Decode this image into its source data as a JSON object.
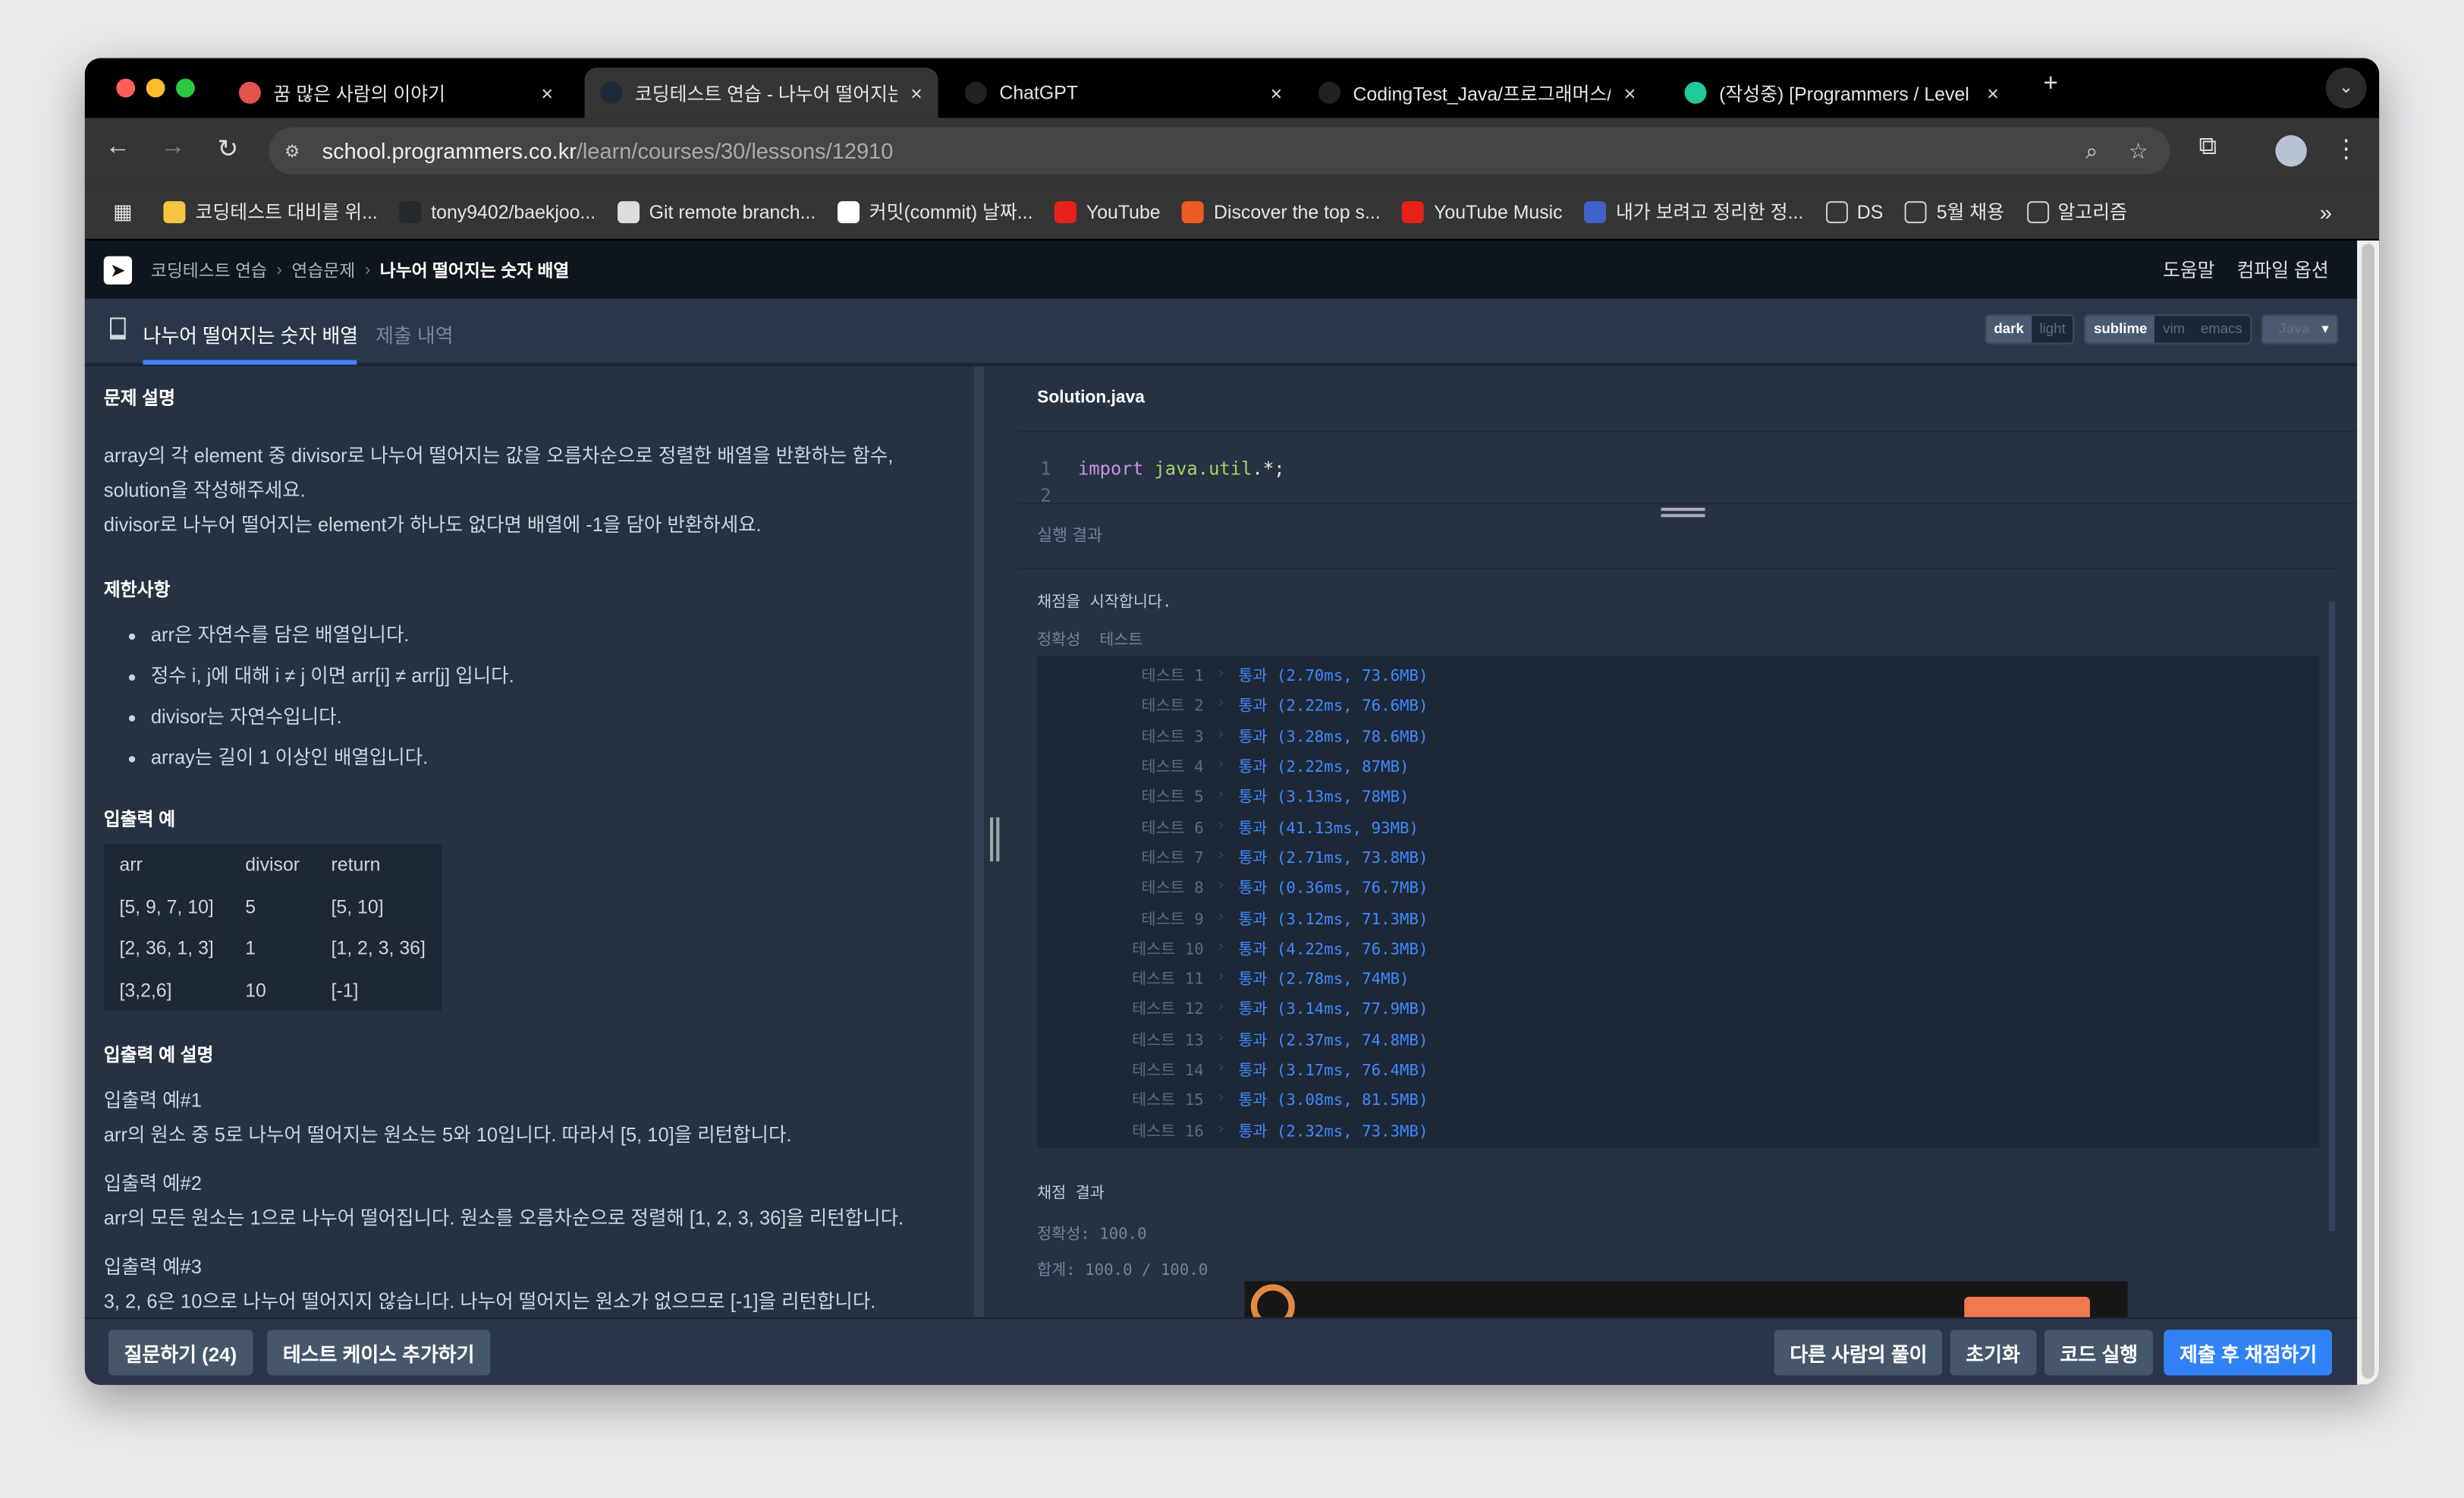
{
  "browser": {
    "tabs": [
      {
        "label": "꿈 많은 사람의 이야기",
        "color": "#e5534b"
      },
      {
        "label": "코딩테스트 연습 - 나누어 떨어지는",
        "color": "#1e2a3a",
        "active": true
      },
      {
        "label": "ChatGPT",
        "color": "#222"
      },
      {
        "label": "CodingTest_Java/프로그래머스/",
        "color": "#222"
      },
      {
        "label": "(작성중) [Programmers / Level",
        "color": "#20c997"
      }
    ],
    "url_host": "school.programmers.co.kr",
    "url_path": "/learn/courses/30/lessons/12910",
    "bookmarks": [
      "코딩테스트 대비를 위...",
      "tony9402/baekjoo...",
      "Git remote branch...",
      "커밋(commit) 날짜...",
      "YouTube",
      "Discover the top s...",
      "YouTube Music",
      "내가 보려고 정리한 정...",
      "DS",
      "5월 채용",
      "알고리즘"
    ],
    "more": "»"
  },
  "header": {
    "breadcrumb": [
      "코딩테스트 연습",
      "연습문제",
      "나누어 떨어지는 숫자 배열"
    ],
    "help": "도움말",
    "compile_options": "컴파일 옵션"
  },
  "tabs": {
    "problem": "나누어 떨어지는 숫자 배열",
    "history": "제출 내역"
  },
  "editor_opts": {
    "theme": [
      "dark",
      "light"
    ],
    "keymap": [
      "sublime",
      "vim",
      "emacs"
    ],
    "language": "Java"
  },
  "problem": {
    "desc_title": "문제 설명",
    "desc": [
      "array의 각 element 중 divisor로 나누어 떨어지는 값을 오름차순으로 정렬한 배열을 반환하는 함수,",
      "solution을 작성해주세요.",
      "divisor로 나누어 떨어지는 element가 하나도 없다면 배열에 -1을 담아 반환하세요."
    ],
    "limits_title": "제한사항",
    "limits": [
      "arr은 자연수를 담은 배열입니다.",
      "정수 i, j에 대해 i ≠ j 이면 arr[i] ≠ arr[j] 입니다.",
      "divisor는 자연수입니다.",
      "array는 길이 1 이상인 배열입니다."
    ],
    "io_title": "입출력 예",
    "io_headers": [
      "arr",
      "divisor",
      "return"
    ],
    "io_rows": [
      [
        "[5, 9, 7, 10]",
        "5",
        "[5, 10]"
      ],
      [
        "[2, 36, 1, 3]",
        "1",
        "[1, 2, 3, 36]"
      ],
      [
        "[3,2,6]",
        "10",
        "[-1]"
      ]
    ],
    "ex_title": "입출력 예 설명",
    "examples": [
      {
        "t": "입출력 예#1",
        "d": "arr의 원소 중 5로 나누어 떨어지는 원소는 5와 10입니다. 따라서 [5, 10]을 리턴합니다."
      },
      {
        "t": "입출력 예#2",
        "d": "arr의 모든 원소는 1으로 나누어 떨어집니다. 원소를 오름차순으로 정렬해 [1, 2, 3, 36]을 리턴합니다."
      },
      {
        "t": "입출력 예#3",
        "d": "3, 2, 6은 10으로 나누어 떨어지지 않습니다. 나누어 떨어지는 원소가 없으므로 [-1]을 리턴합니다."
      }
    ]
  },
  "editor": {
    "filename": "Solution.java",
    "lines": [
      {
        "n": "1",
        "kw": "import",
        "rest": " java.util",
        "tail": ".*;"
      },
      {
        "n": "2"
      }
    ]
  },
  "result": {
    "label": "실행 결과",
    "start": "채점을 시작합니다.",
    "section": "정확성  테스트",
    "tests": [
      [
        "테스트 1",
        "통과 (2.70ms, 73.6MB)"
      ],
      [
        "테스트 2",
        "통과 (2.22ms, 76.6MB)"
      ],
      [
        "테스트 3",
        "통과 (3.28ms, 78.6MB)"
      ],
      [
        "테스트 4",
        "통과 (2.22ms, 87MB)"
      ],
      [
        "테스트 5",
        "통과 (3.13ms, 78MB)"
      ],
      [
        "테스트 6",
        "통과 (41.13ms, 93MB)"
      ],
      [
        "테스트 7",
        "통과 (2.71ms, 73.8MB)"
      ],
      [
        "테스트 8",
        "통과 (0.36ms, 76.7MB)"
      ],
      [
        "테스트 9",
        "통과 (3.12ms, 71.3MB)"
      ],
      [
        "테스트 10",
        "통과 (4.22ms, 76.3MB)"
      ],
      [
        "테스트 11",
        "통과 (2.78ms, 74MB)"
      ],
      [
        "테스트 12",
        "통과 (3.14ms, 77.9MB)"
      ],
      [
        "테스트 13",
        "통과 (2.37ms, 74.8MB)"
      ],
      [
        "테스트 14",
        "통과 (3.17ms, 76.4MB)"
      ],
      [
        "테스트 15",
        "통과 (3.08ms, 81.5MB)"
      ],
      [
        "테스트 16",
        "통과 (2.32ms, 73.3MB)"
      ]
    ],
    "score_title": "채점 결과",
    "accuracy": "정확성: 100.0",
    "total": "합계: 100.0 / 100.0"
  },
  "buttons": {
    "question": "질문하기 (24)",
    "add_test": "테스트 케이스 추가하기",
    "others": "다른 사람의 풀이",
    "reset": "초기화",
    "run": "코드 실행",
    "submit": "제출 후 채점하기"
  },
  "colors": {
    "accent": "#3182f6",
    "pass": "#3d8bff",
    "bg": "#263241"
  }
}
